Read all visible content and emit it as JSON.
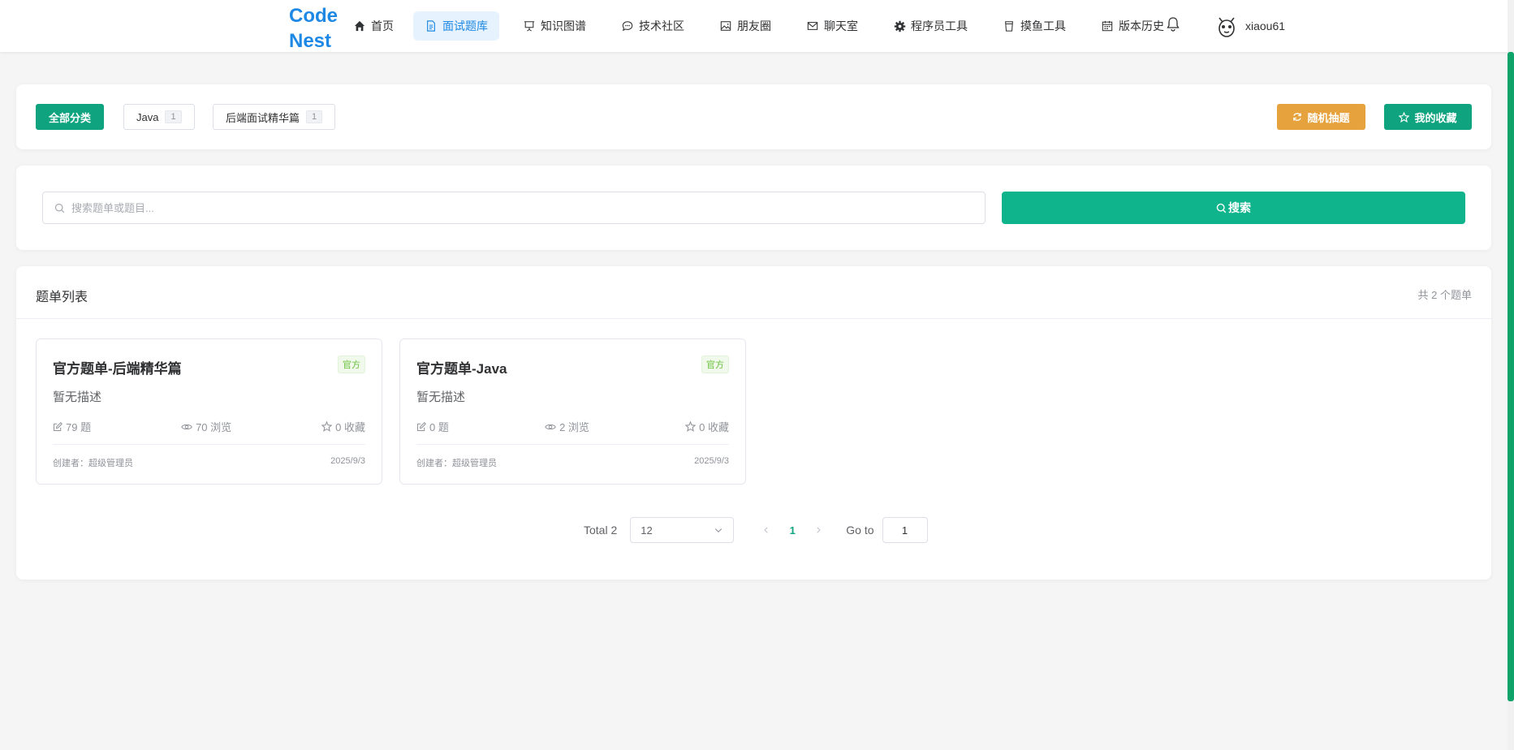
{
  "header": {
    "logo_line1": "Code",
    "logo_line2": "Nest",
    "nav": [
      {
        "label": "首页",
        "icon": "home-icon"
      },
      {
        "label": "面试题库",
        "icon": "document-icon",
        "active": true
      },
      {
        "label": "知识图谱",
        "icon": "presentation-icon"
      },
      {
        "label": "技术社区",
        "icon": "chat-icon"
      },
      {
        "label": "朋友圈",
        "icon": "picture-icon"
      },
      {
        "label": "聊天室",
        "icon": "message-icon"
      },
      {
        "label": "程序员工具",
        "icon": "gear-icon"
      },
      {
        "label": "摸鱼工具",
        "icon": "cup-icon"
      },
      {
        "label": "版本历史",
        "icon": "calendar-icon"
      }
    ],
    "username": "xiaou61"
  },
  "categories": {
    "items": [
      {
        "label": "全部分类",
        "active": true
      },
      {
        "label": "Java",
        "count": "1"
      },
      {
        "label": "后端面试精华篇",
        "count": "1"
      }
    ],
    "random_label": "随机抽题",
    "favorites_label": "我的收藏"
  },
  "search": {
    "placeholder": "搜索题单或题目...",
    "button_label": "搜索"
  },
  "list": {
    "title": "题单列表",
    "total_text": "共 2 个题单",
    "cards": [
      {
        "title": "官方题单-后端精华篇",
        "badge": "官方",
        "desc": "暂无描述",
        "questions": "79 题",
        "views": "70 浏览",
        "favorites": "0 收藏",
        "creator": "创建者：超级管理员",
        "date": "2025/9/3"
      },
      {
        "title": "官方题单-Java",
        "badge": "官方",
        "desc": "暂无描述",
        "questions": "0 题",
        "views": "2 浏览",
        "favorites": "0 收藏",
        "creator": "创建者：超级管理员",
        "date": "2025/9/3"
      }
    ]
  },
  "pagination": {
    "total_text": "Total 2",
    "page_size": "12",
    "current_page": "1",
    "goto_label": "Go to",
    "goto_value": "1"
  },
  "colors": {
    "primary": "#0fa37f",
    "brand_blue": "#1e88e5",
    "warning": "#e6a23c",
    "success_tag": "#67c23a"
  }
}
